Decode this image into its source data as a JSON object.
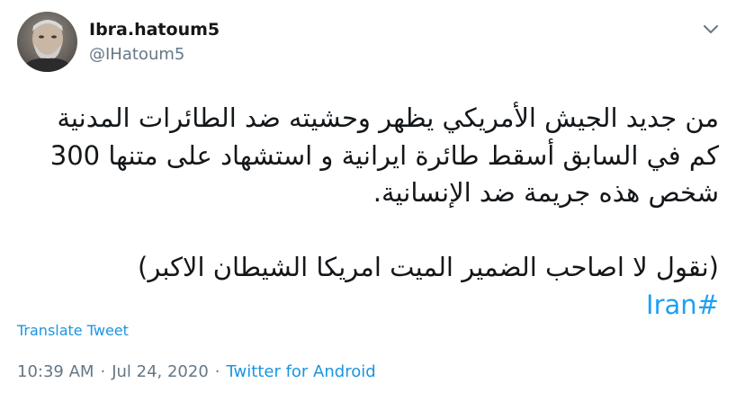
{
  "author": {
    "name": "Ibra.hatoum5",
    "handle": "@IHatoum5"
  },
  "tweet": {
    "lines": [
      "من جديد الجيش الأمريكي يظهر وحشيته ضد الطائرات المدنية",
      "كم في السابق أسقط طائرة ايرانية و استشهاد على متنها 300",
      "شخص هذه جريمة ضد الإنسانية."
    ],
    "quote_line": "(نقول لا اصاحب الضمير الميت امريكا الشيطان الاكبر)",
    "hashtag": "#Iran"
  },
  "translate_label": "Translate Tweet",
  "meta": {
    "time": "10:39 AM",
    "separator_1": "·",
    "date": "Jul 24, 2020",
    "separator_2": "·",
    "source": "Twitter for Android"
  },
  "icons": {
    "avatar": "user-avatar-photo",
    "more": "chevron-down-icon"
  },
  "colors": {
    "text": "#14171a",
    "secondary": "#657786",
    "link": "#1da1f2",
    "translate": "#1b95e0"
  }
}
